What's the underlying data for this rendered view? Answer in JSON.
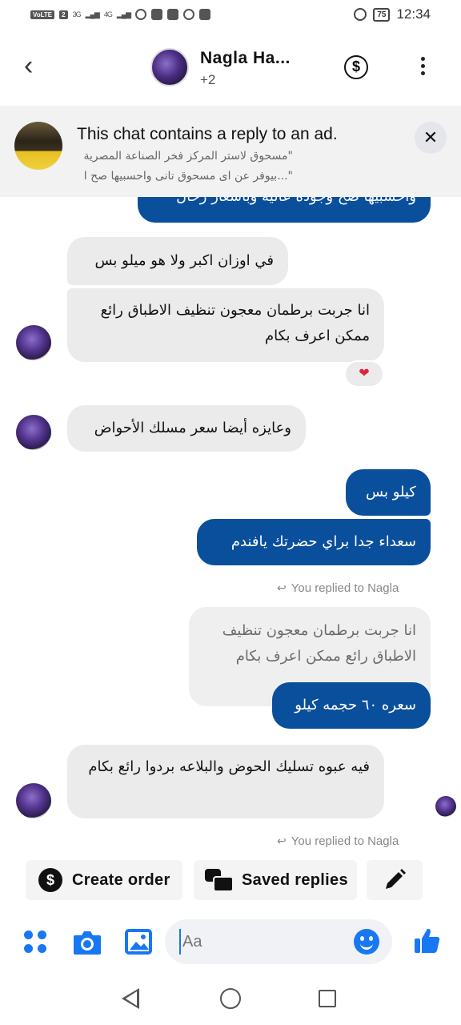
{
  "status_bar": {
    "volte": "VoLTE",
    "sim": "2",
    "net1": "3G",
    "net2": "4G",
    "battery": "75",
    "time": "12:34"
  },
  "header": {
    "name": "Nagla Ha...",
    "subtitle": "+2",
    "back_icon": "back-arrow-icon",
    "dollar_icon": "dollar-icon",
    "more_icon": "more-vertical-icon"
  },
  "ad_banner": {
    "title": "This chat contains a reply to an ad.",
    "line1": "\"مسحوق لاستر المركز فخر الصناعة المصرية",
    "line2": "\"...بيوفر عن اى مسحوق تانى واحسبيها صح ا"
  },
  "messages": [
    {
      "dir": "out",
      "text": "واحسبيها صح وجودة عالية وباسعار رخال"
    },
    {
      "dir": "in",
      "text": "في اوزان اكبر ولا هو ميلو بس"
    },
    {
      "dir": "in",
      "text": "انا جربت برطمان معجون تنظيف الاطباق رائع ممكن اعرف بكام",
      "reaction": "❤"
    },
    {
      "dir": "in",
      "text": "وعايزه أيضا سعر مسلك الأحواض"
    },
    {
      "dir": "out",
      "text": "كيلو بس"
    },
    {
      "dir": "out",
      "text": "سعداء جدا براي حضرتك يافندم"
    },
    {
      "dir": "meta",
      "text": "You replied to Nagla"
    },
    {
      "dir": "quote",
      "text": "انا جربت برطمان معجون تنظيف الاطباق رائع ممكن اعرف بكام"
    },
    {
      "dir": "out",
      "text": "سعره ٦٠ حجمه كيلو"
    },
    {
      "dir": "in",
      "text": "فيه عبوه تسليك الحوض والبلاعه بردوا رائع بكام"
    },
    {
      "dir": "meta",
      "text": "You replied to Nagla"
    }
  ],
  "actions": {
    "create_order": "Create order",
    "saved_replies": "Saved replies",
    "edit_icon": "pencil-icon"
  },
  "composer": {
    "placeholder": "Aa",
    "menu_icon": "grid-dots-icon",
    "camera_icon": "camera-icon",
    "gallery_icon": "image-icon",
    "emoji_icon": "emoji-icon",
    "like_icon": "thumbs-up-icon"
  },
  "colors": {
    "outgoing_bubble": "#0a4f9c",
    "incoming_bubble": "#ebebeb",
    "accent": "#1877f2"
  }
}
